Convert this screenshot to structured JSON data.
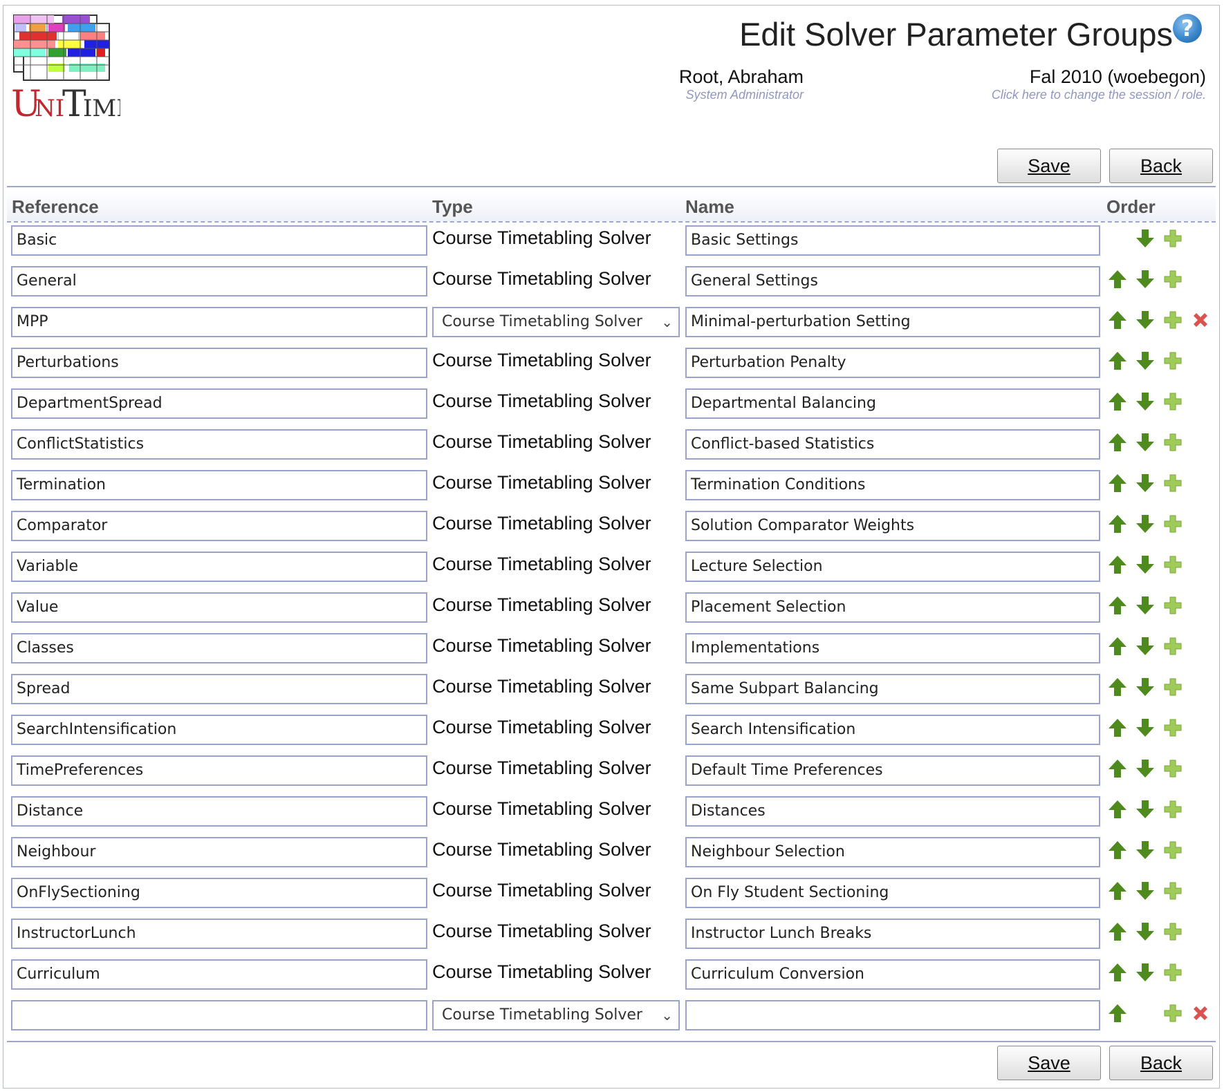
{
  "header": {
    "title": "Edit Solver Parameter Groups",
    "help_glyph": "?",
    "user_name": "Root, Abraham",
    "user_role": "System Administrator",
    "session_name": "Fal 2010 (woebegon)",
    "session_hint": "Click here to change the session / role."
  },
  "buttons": {
    "save": "Save",
    "back": "Back"
  },
  "columns": {
    "reference": "Reference",
    "type": "Type",
    "name": "Name",
    "order": "Order"
  },
  "colors": {
    "up_down_arrow": "#4f8a1f",
    "add": "#9ecb5a",
    "delete": "#d9534f",
    "field_border": "#9aa3c9"
  },
  "rows": [
    {
      "reference": "Basic",
      "type": "Course Timetabling Solver",
      "name": "Basic Settings"
    },
    {
      "reference": "General",
      "type": "Course Timetabling Solver",
      "name": "General Settings"
    },
    {
      "reference": "MPP",
      "type": "Course Timetabling Solver",
      "name": "Minimal-perturbation Setting"
    },
    {
      "reference": "Perturbations",
      "type": "Course Timetabling Solver",
      "name": "Perturbation Penalty"
    },
    {
      "reference": "DepartmentSpread",
      "type": "Course Timetabling Solver",
      "name": "Departmental Balancing"
    },
    {
      "reference": "ConflictStatistics",
      "type": "Course Timetabling Solver",
      "name": "Conflict-based Statistics"
    },
    {
      "reference": "Termination",
      "type": "Course Timetabling Solver",
      "name": "Termination Conditions"
    },
    {
      "reference": "Comparator",
      "type": "Course Timetabling Solver",
      "name": "Solution Comparator Weights"
    },
    {
      "reference": "Variable",
      "type": "Course Timetabling Solver",
      "name": "Lecture Selection"
    },
    {
      "reference": "Value",
      "type": "Course Timetabling Solver",
      "name": "Placement Selection"
    },
    {
      "reference": "Classes",
      "type": "Course Timetabling Solver",
      "name": "Implementations"
    },
    {
      "reference": "Spread",
      "type": "Course Timetabling Solver",
      "name": "Same Subpart Balancing"
    },
    {
      "reference": "SearchIntensification",
      "type": "Course Timetabling Solver",
      "name": "Search Intensification"
    },
    {
      "reference": "TimePreferences",
      "type": "Course Timetabling Solver",
      "name": "Default Time Preferences"
    },
    {
      "reference": "Distance",
      "type": "Course Timetabling Solver",
      "name": "Distances"
    },
    {
      "reference": "Neighbour",
      "type": "Course Timetabling Solver",
      "name": "Neighbour Selection"
    },
    {
      "reference": "OnFlySectioning",
      "type": "Course Timetabling Solver",
      "name": "On Fly Student Sectioning"
    },
    {
      "reference": "InstructorLunch",
      "type": "Course Timetabling Solver",
      "name": "Instructor Lunch Breaks"
    },
    {
      "reference": "Curriculum",
      "type": "Course Timetabling Solver",
      "name": "Curriculum Conversion"
    },
    {
      "reference": "",
      "type": "Course Timetabling Solver",
      "name": ""
    }
  ]
}
